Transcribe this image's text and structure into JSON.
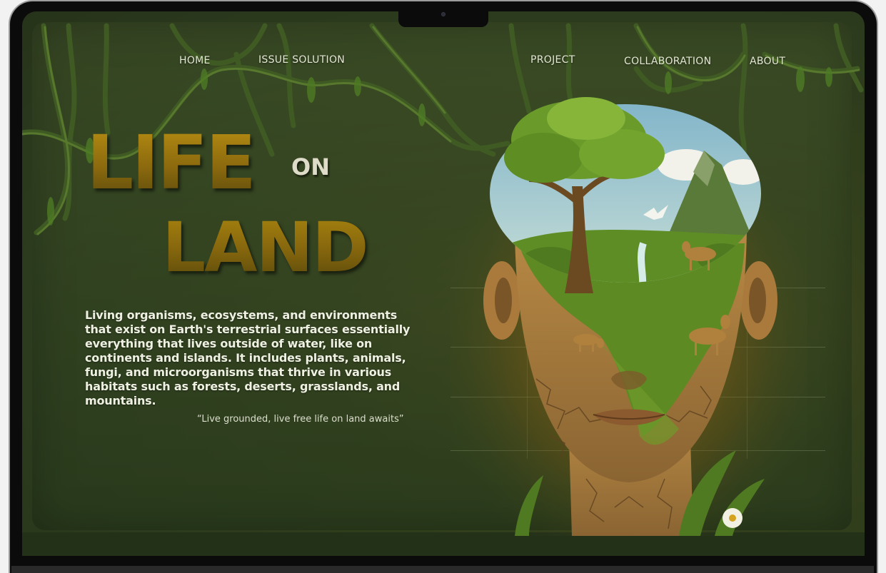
{
  "nav": {
    "items": [
      {
        "label": "HOME"
      },
      {
        "label": "ISSUE SOLUTION"
      },
      {
        "label": "PROJECT"
      },
      {
        "label": "COLLABORATION"
      },
      {
        "label": "ABOUT"
      }
    ]
  },
  "hero": {
    "title_word_1": "LIFE",
    "title_word_2": "ON",
    "title_word_3": "LAND",
    "description": "Living organisms, ecosystems, and environments that exist on Earth's terrestrial surfaces essentially everything that lives outside of water, like on continents and islands. It includes plants, animals, fungi, and microorganisms that thrive in various habitats such as forests, deserts, grasslands, and mountains.",
    "quote": "“Live grounded, live free life on land awaits”"
  },
  "colors": {
    "background": "#2c3b1d",
    "title_gold": "#8c6a0e",
    "text_light": "#eef0e2"
  }
}
